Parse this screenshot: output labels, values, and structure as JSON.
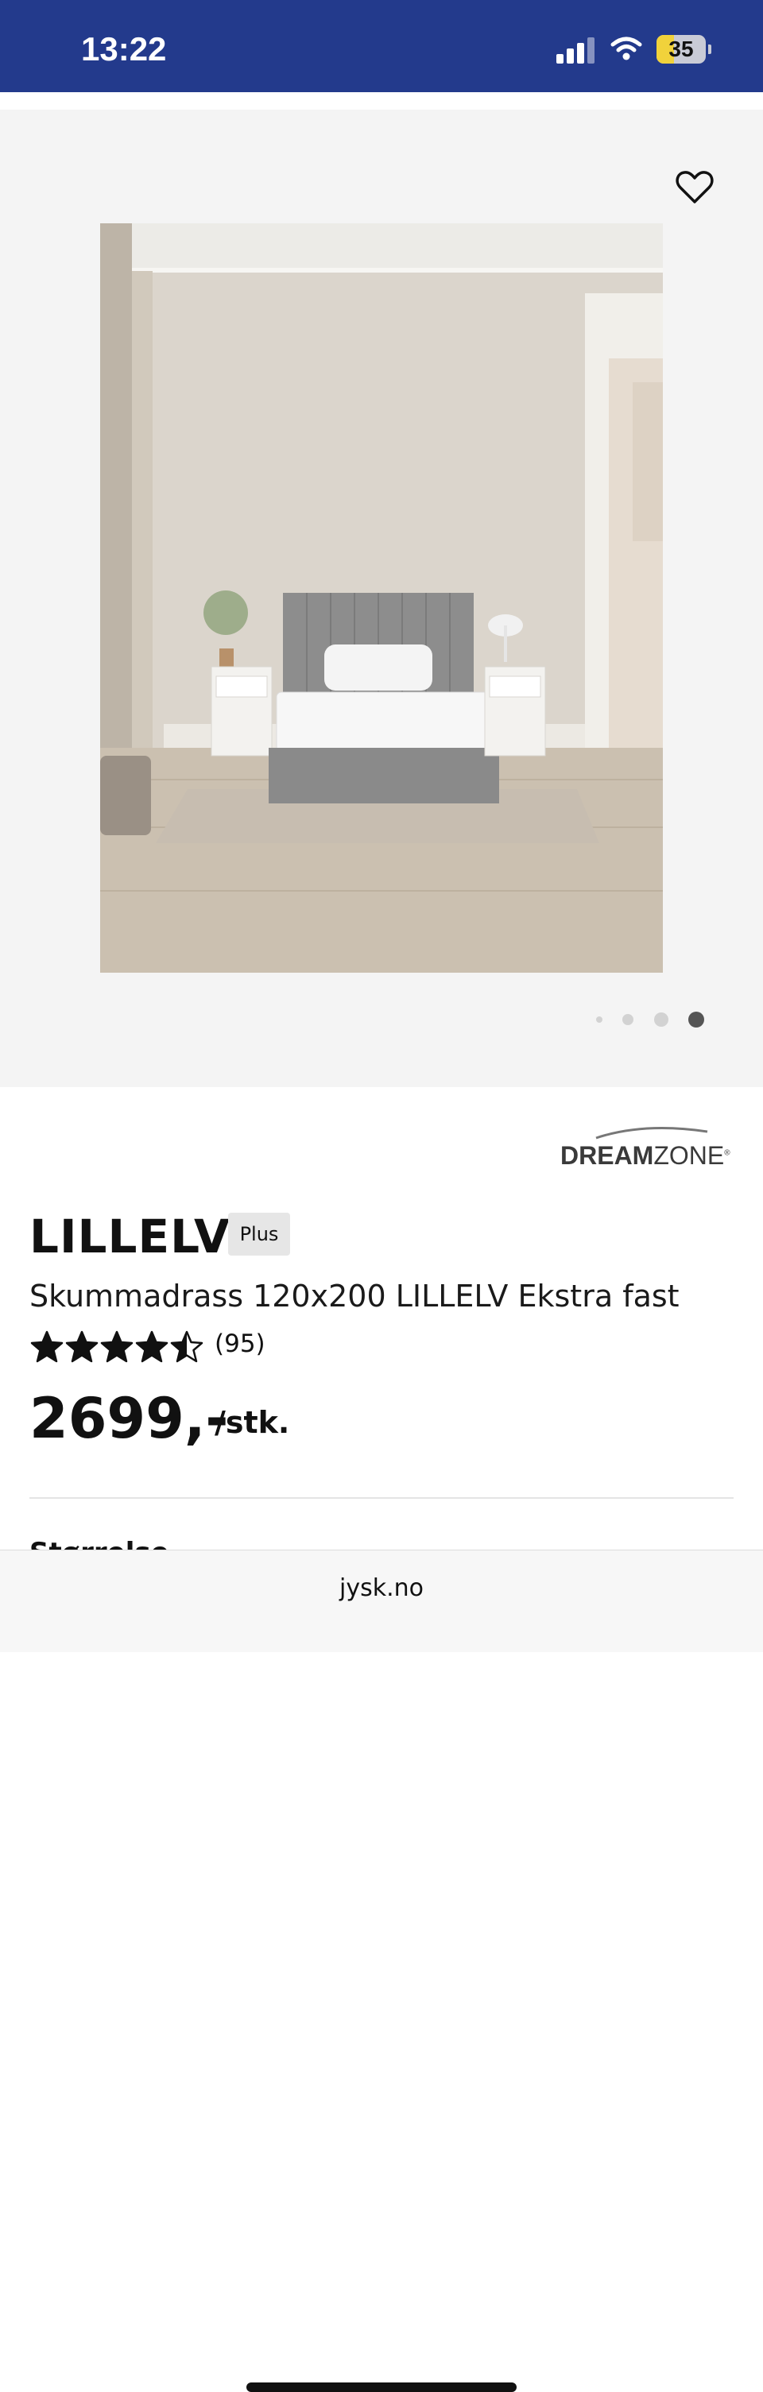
{
  "status_bar": {
    "time": "13:22",
    "battery": "35",
    "battery_level": 0.35,
    "bg_color": "#233a8c"
  },
  "gallery": {
    "image_alt": "bedroom-with-grey-bed-and-mattress",
    "favorite_icon": "heart-icon",
    "carousel": {
      "total": 4,
      "active_index": 3
    }
  },
  "product": {
    "brand": "DREAMZONE",
    "brand_bold": "DREAM",
    "brand_light": "ZONE",
    "name": "LILLELV",
    "badge": "Plus",
    "subtitle": "Skummadrass 120x200 LILLELV Ekstra fast",
    "rating": 4.5,
    "rating_max": 5,
    "review_count": "(95)",
    "price": "2699,-",
    "unit": "/stk.",
    "next_section_peek": "Størrelse"
  },
  "browser": {
    "url": "jysk.no"
  }
}
